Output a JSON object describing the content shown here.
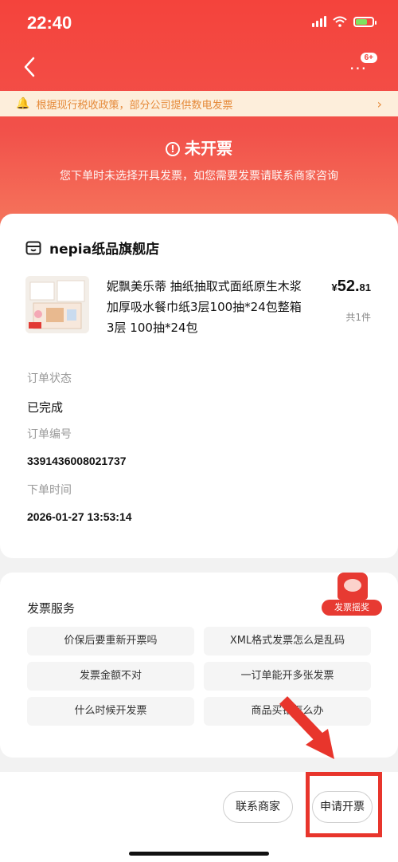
{
  "status_bar": {
    "time": "22:40"
  },
  "nav": {
    "badge": "6+"
  },
  "notice": {
    "text": "根据现行税收政策，部分公司提供数电发票",
    "arrow": "›"
  },
  "invoice": {
    "status": "未开票",
    "subtitle": "您下单时未选择开具发票，如您需要发票请联系商家咨询"
  },
  "order": {
    "store_name": "nepia纸品旗舰店",
    "product": {
      "title": "妮飘美乐蒂 抽纸抽取式面纸原生木浆加厚吸水餐巾纸3层100抽*24包整箱 3层 100抽*24包",
      "price_symbol": "¥",
      "price_int": "52.",
      "price_dec": "81",
      "quantity": "共1件"
    },
    "fields": {
      "status_label": "订单状态",
      "status_value": "已完成",
      "order_no_label": "订单编号",
      "order_no_value": "3391436008021737",
      "time_label": "下单时间",
      "time_value": "2026-01-27 13:53:14"
    }
  },
  "service": {
    "title": "发票服务",
    "lottery_label": "发票摇奖",
    "chips": [
      "价保后要重新开票吗",
      "XML格式发票怎么是乱码",
      "发票金额不对",
      "一订单能开多张发票",
      "什么时候开发票",
      "商品买错怎么办"
    ]
  },
  "actions": {
    "contact": "联系商家",
    "apply": "申请开票"
  },
  "colors": {
    "brand_red": "#f2433b",
    "notice_bg": "#fdeedb",
    "notice_text": "#e58a3a",
    "highlight": "#e8352c"
  }
}
